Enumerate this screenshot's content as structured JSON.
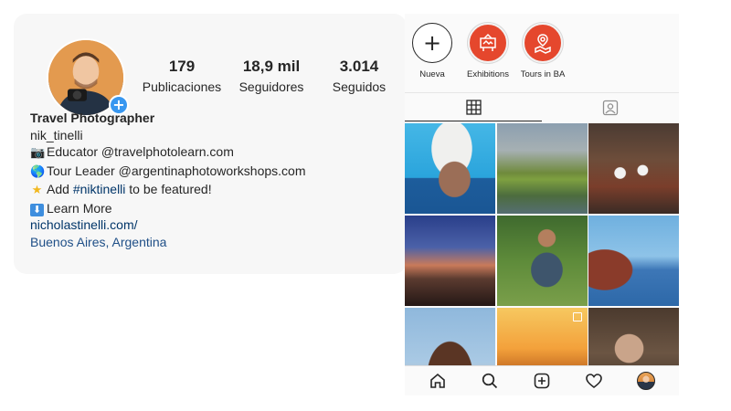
{
  "profile": {
    "stats": [
      {
        "value": "179",
        "label": "Publicaciones"
      },
      {
        "value": "18,9 mil",
        "label": "Seguidores"
      },
      {
        "value": "3.014",
        "label": "Seguidos"
      }
    ],
    "bio": {
      "name": "Travel Photographer",
      "username": "nik_tinelli",
      "line1": "Educator @travelphotolearn.com",
      "line2": "Tour Leader @argentinaphotoworkshops.com",
      "line3_prefix": "Add ",
      "line3_hashtag": "#niktinelli",
      "line3_suffix": " to be featured!",
      "line4": "Learn More",
      "link": "nicholastinelli.com/",
      "location": "Buenos Aires, Argentina"
    }
  },
  "highlights": [
    {
      "label": "Nueva",
      "icon": "plus-icon"
    },
    {
      "label": "Exhibitions",
      "icon": "exhibition-icon"
    },
    {
      "label": "Tours in BA",
      "icon": "map-pin-icon"
    }
  ],
  "tabs": [
    {
      "icon": "grid-icon",
      "active": true
    },
    {
      "icon": "tagged-icon",
      "active": false
    }
  ],
  "bottom_nav": [
    {
      "icon": "home-icon"
    },
    {
      "icon": "search-icon"
    },
    {
      "icon": "new-post-icon"
    },
    {
      "icon": "heart-icon"
    },
    {
      "icon": "profile-avatar"
    }
  ],
  "colors": {
    "link": "#003569",
    "highlight_red": "#e5472d",
    "badge_blue": "#3897f0"
  }
}
